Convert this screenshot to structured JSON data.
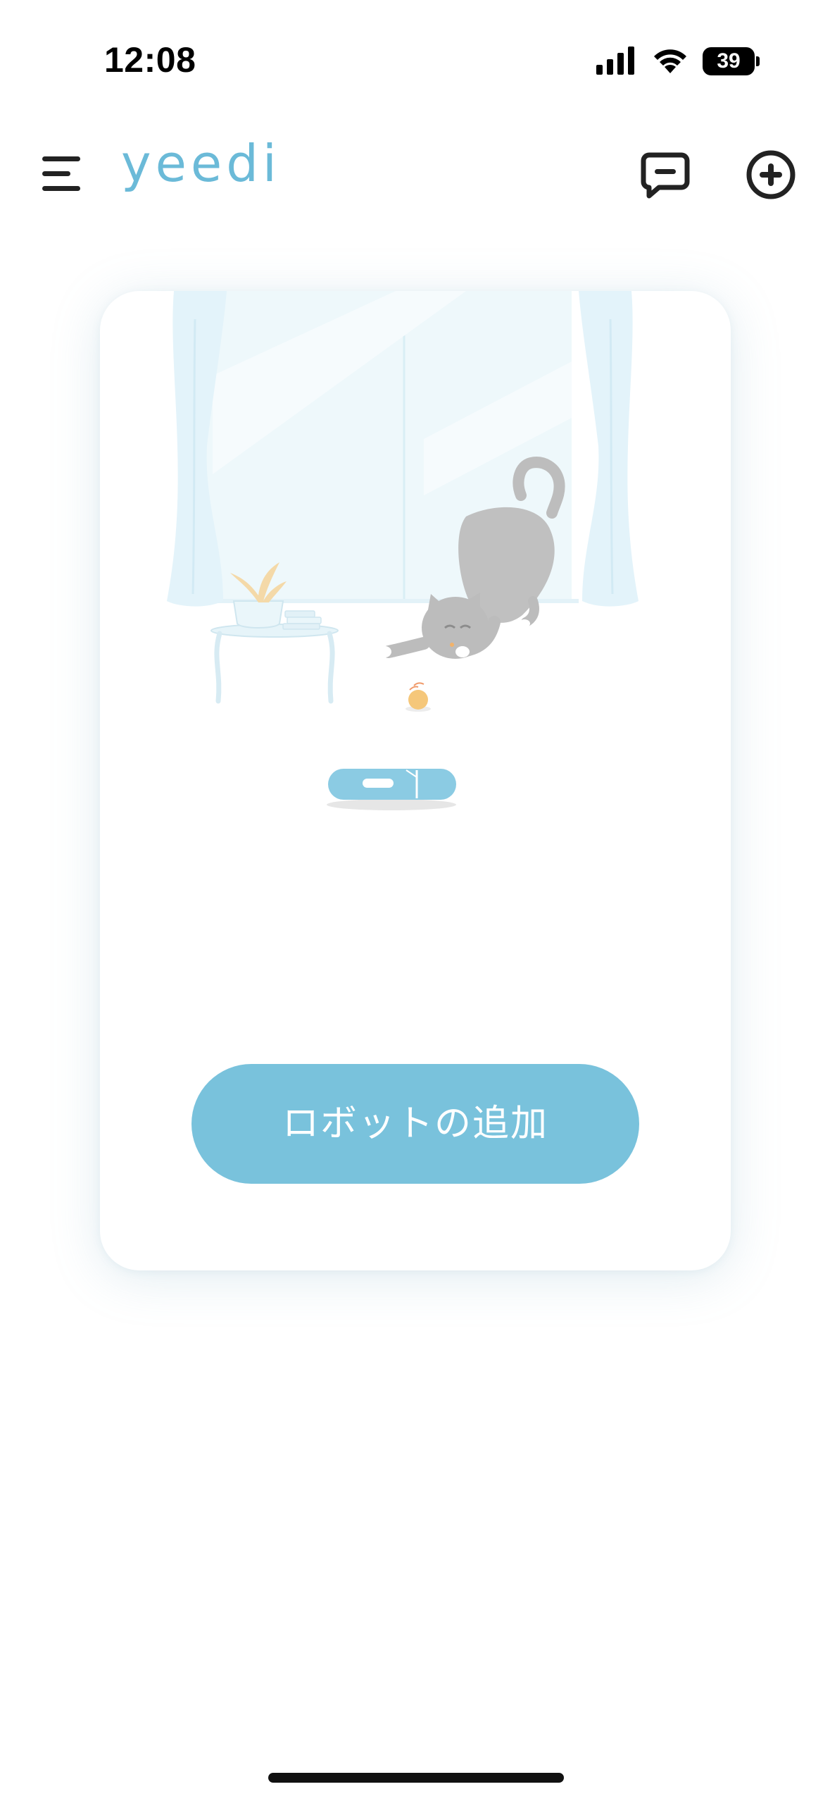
{
  "status_bar": {
    "time": "12:08",
    "battery_level": "39",
    "icons": [
      "signal-icon",
      "wifi-icon",
      "battery-icon"
    ]
  },
  "header": {
    "brand": "yeedi",
    "brand_color": "#6bbad8",
    "icons": [
      "menu-icon",
      "message-icon",
      "add-circle-icon"
    ]
  },
  "card": {
    "illustration": "room-with-cat-and-robot-vacuum",
    "add_robot_label": "ロボットの追加",
    "button_color": "#79c2dc"
  }
}
